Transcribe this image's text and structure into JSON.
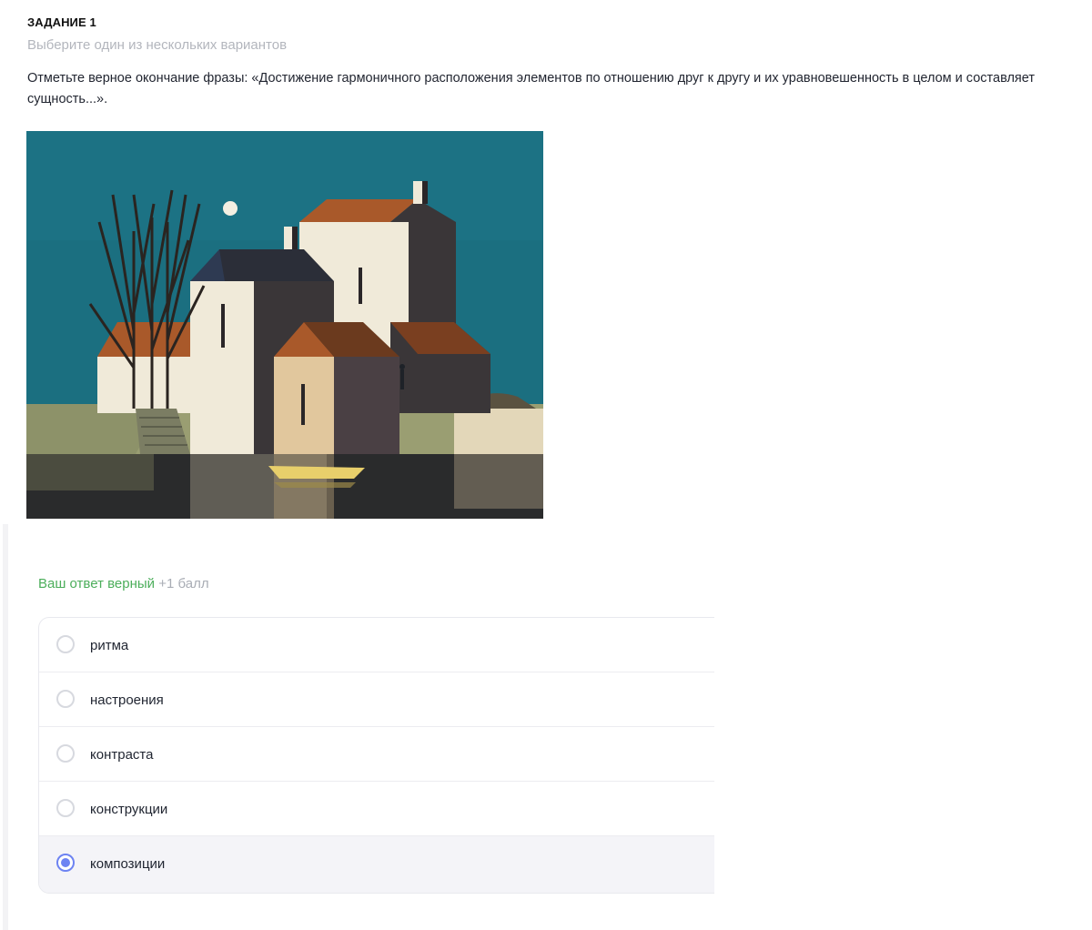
{
  "task": {
    "title": "ЗАДАНИЕ 1",
    "subtitle": "Выберите один из нескольких вариантов",
    "question": "Отметьте верное окончание фразы: «Достижение гармоничного расположения элементов по отношению друг к другу и их уравновешенность в целом и составляет сущность...»."
  },
  "picture": {
    "colors": {
      "sky": "#1b6f80",
      "roof": "#a9592a",
      "wall_light": "#f0ead9",
      "wall_dark": "#3a3638",
      "wall_tan": "#e1c79d",
      "ground": "#9a9e72",
      "water": "#2a2b2c",
      "boat": "#e8cf6b"
    }
  },
  "result": {
    "status": "Ваш ответ верный",
    "points": "+1 балл",
    "status_color": "#4cae5b"
  },
  "options": [
    {
      "label": "ритма",
      "selected": false
    },
    {
      "label": "настроения",
      "selected": false
    },
    {
      "label": "контраста",
      "selected": false
    },
    {
      "label": "конструкции",
      "selected": false
    },
    {
      "label": "композиции",
      "selected": true
    }
  ],
  "accent_color": "#6d83f2"
}
